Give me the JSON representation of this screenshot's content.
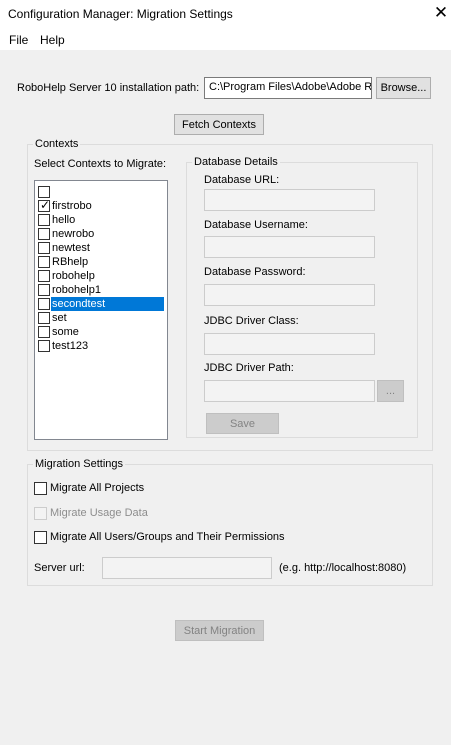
{
  "window": {
    "title": "Configuration Manager: Migration Settings",
    "close": "✕"
  },
  "menu": {
    "file": "File",
    "help": "Help"
  },
  "install": {
    "label": "RoboHelp Server 10 installation path:",
    "value": "C:\\Program Files\\Adobe\\Adobe R",
    "browse": "Browse..."
  },
  "fetch_label": "Fetch Contexts",
  "contexts": {
    "legend": "Contexts",
    "select_label": "Select Contexts to Migrate:",
    "items": [
      {
        "label": "",
        "checked": false,
        "selected": false
      },
      {
        "label": "firstrobo",
        "checked": true,
        "selected": false
      },
      {
        "label": "hello",
        "checked": false,
        "selected": false
      },
      {
        "label": "newrobo",
        "checked": false,
        "selected": false
      },
      {
        "label": "newtest",
        "checked": false,
        "selected": false
      },
      {
        "label": "RBhelp",
        "checked": false,
        "selected": false
      },
      {
        "label": "robohelp",
        "checked": false,
        "selected": false
      },
      {
        "label": "robohelp1",
        "checked": false,
        "selected": false
      },
      {
        "label": "secondtest",
        "checked": false,
        "selected": true
      },
      {
        "label": "set",
        "checked": false,
        "selected": false
      },
      {
        "label": "some",
        "checked": false,
        "selected": false
      },
      {
        "label": "test123",
        "checked": false,
        "selected": false
      }
    ]
  },
  "db": {
    "legend": "Database Details",
    "url_label": "Database URL:",
    "username_label": "Database Username:",
    "password_label": "Database Password:",
    "jdbc_class_label": "JDBC Driver Class:",
    "jdbc_path_label": "JDBC Driver Path:",
    "dots": "...",
    "save": "Save"
  },
  "migration": {
    "legend": "Migration Settings",
    "all_projects": "Migrate All Projects",
    "usage_data": "Migrate Usage Data",
    "users_groups": "Migrate All Users/Groups and Their Permissions",
    "server_url_label": "Server url:",
    "server_url_hint": "(e.g. http://localhost:8080)"
  },
  "start_label": "Start Migration"
}
